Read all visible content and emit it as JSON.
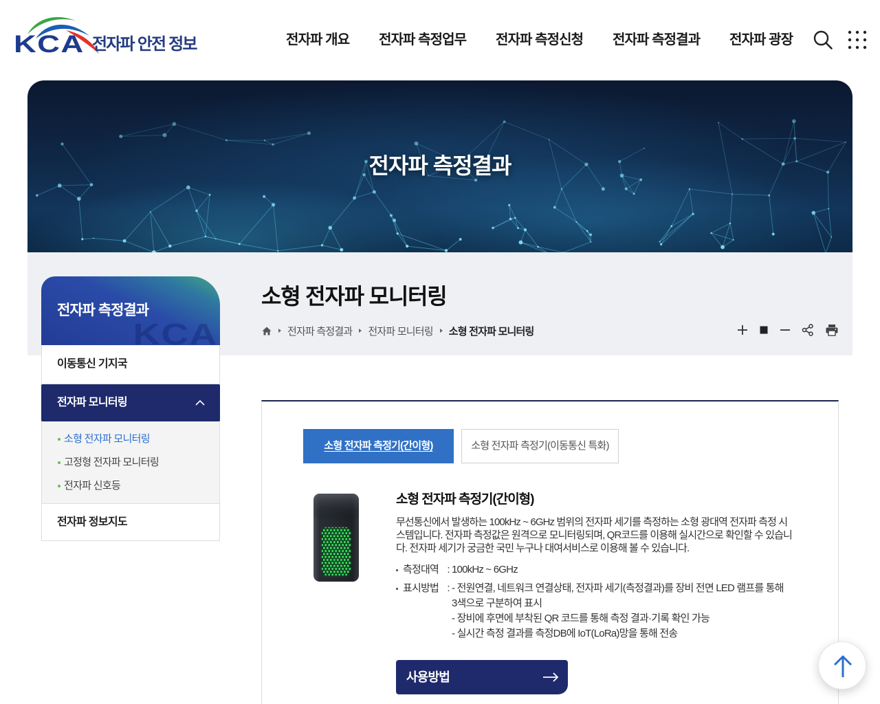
{
  "colors": {
    "primary_navy": "#1e2a6b",
    "tab_active_blue": "#3071c6",
    "submenu_bullet_green": "#6cbd45",
    "active_link_blue": "#2a6fd0",
    "logo_navy": "#1d3b8e"
  },
  "header": {
    "logo_text": "KCA",
    "site_title": "전자파 안전 정보",
    "nav": [
      {
        "label": "전자파 개요"
      },
      {
        "label": "전자파 측정업무"
      },
      {
        "label": "전자파 측정신청"
      },
      {
        "label": "전자파 측정결과"
      },
      {
        "label": "전자파 광장"
      }
    ],
    "search_icon": "search-icon",
    "menu_icon": "grid-menu-icon"
  },
  "hero": {
    "title": "전자파 측정결과"
  },
  "sidebar": {
    "title": "전자파 측정결과",
    "watermark": "KCA",
    "items": [
      {
        "label": "이동통신 기지국",
        "active": false
      },
      {
        "label": "전자파 모니터링",
        "active": true,
        "expanded": true,
        "toggle_icon": "chevron-up-icon",
        "children": [
          {
            "label": "소형 전자파 모니터링",
            "active": true
          },
          {
            "label": "고정형 전자파 모니터링",
            "active": false
          },
          {
            "label": "전자파 신호등",
            "active": false
          }
        ]
      },
      {
        "label": "전자파 정보지도",
        "active": false
      }
    ]
  },
  "page": {
    "title": "소형 전자파 모니터링",
    "breadcrumb": {
      "home_icon": "home-icon",
      "items": [
        "전자파 측정결과",
        "전자파 모니터링",
        "소형 전자파 모니터링"
      ]
    },
    "tools": [
      "zoom-in-icon",
      "zoom-reset-icon",
      "zoom-out-icon",
      "share-icon",
      "print-icon"
    ]
  },
  "tabs": [
    {
      "label": "소형 전자파 측정기(간이형)",
      "active": true
    },
    {
      "label": "소형 전자파 측정기(이동통신 특화)",
      "active": false
    }
  ],
  "product": {
    "title": "소형 전자파 측정기(간이형)",
    "description": "무선통신에서 발생하는 100kHz ~ 6GHz 범위의 전자파 세기를 측정하는 소형 광대역 전자파 측정 시스템입니다. 전자파 측정값은 원격으로 모니터링되며, QR코드를 이용해 실시간으로 확인할 수 있습니다. 전자파 세기가 궁금한 국민 누구나 대여서비스로 이용해 볼 수 있습니다.",
    "specs": [
      {
        "label": "측정대역",
        "separator": ":",
        "values": [
          "100kHz ~ 6GHz"
        ]
      },
      {
        "label": "표시방법",
        "separator": ":",
        "values": [
          "- 전원연결, 네트워크 연결상태, 전자파 세기(측정결과)를 장비 전면 LED 램프를 통해 3색으로 구분하여 표시",
          "- 장비에 후면에 부착된 QR 코드를 통해 측정 결과·기록 확인 가능",
          "- 실시간 측정 결과를 측정DB에 IoT(LoRa)망을 통해 전송"
        ]
      }
    ],
    "button": {
      "label": "사용방법",
      "icon": "arrow-right-icon"
    }
  },
  "scroll_top": {
    "icon": "arrow-up-icon"
  }
}
